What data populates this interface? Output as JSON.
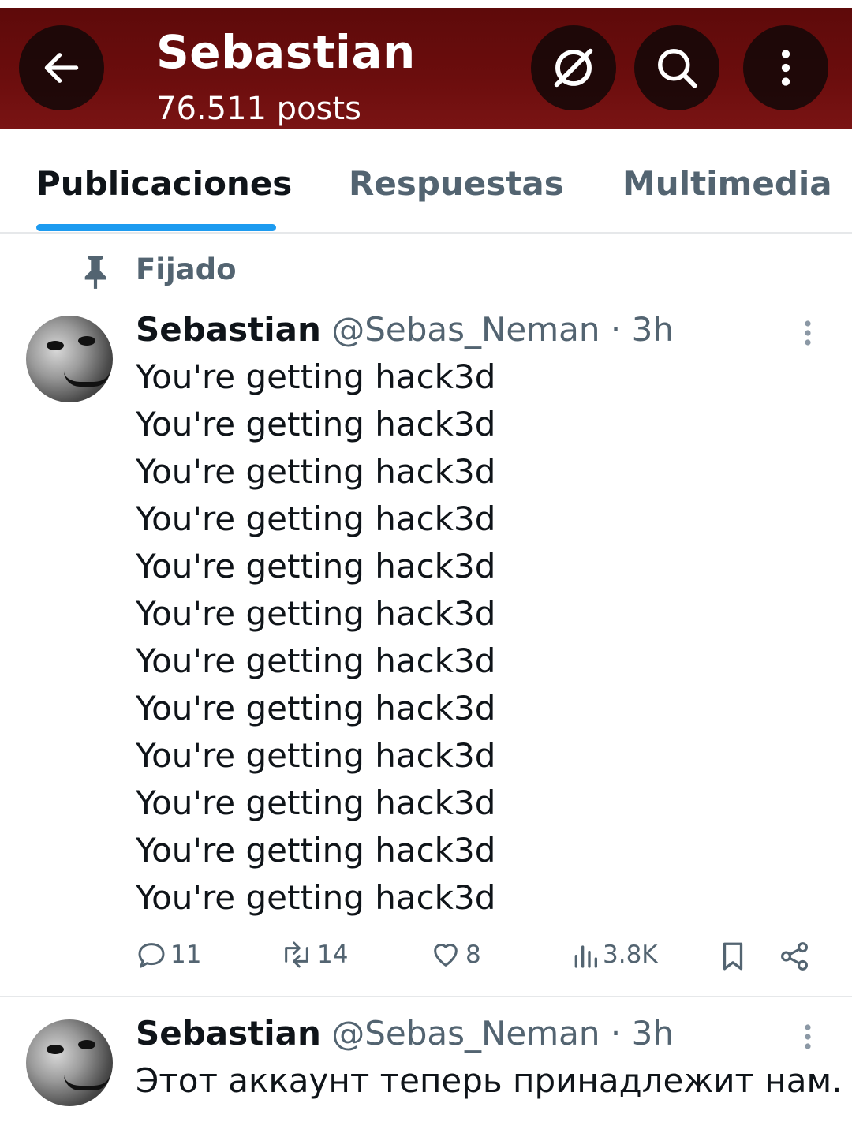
{
  "header": {
    "title": "Sebastian",
    "post_count": "76.511 posts",
    "icons": [
      "back-arrow-icon",
      "no-symbol-icon",
      "search-icon",
      "more-vertical-icon"
    ],
    "background": "#6b0d0d"
  },
  "tabs": [
    {
      "label": "Publicaciones",
      "active": true
    },
    {
      "label": "Respuestas",
      "active": false
    },
    {
      "label": "Multimedia",
      "active": false
    }
  ],
  "accent": "#1d9bf0",
  "pinned_label": "Fijado",
  "tweets": [
    {
      "name": "Sebastian",
      "handle": "@Sebas_Neman",
      "time": "· 3h",
      "lines": [
        "You're getting hack3d",
        "You're getting hack3d",
        "You're getting hack3d",
        "You're getting hack3d",
        "You're getting hack3d",
        "You're getting hack3d",
        "You're getting hack3d",
        "You're getting hack3d",
        "You're getting hack3d",
        "You're getting hack3d",
        "You're getting hack3d",
        "You're getting hack3d"
      ],
      "replies": "11",
      "reposts": "14",
      "likes": "8",
      "views": "3.8K"
    },
    {
      "name": "Sebastian",
      "handle": "@Sebas_Neman",
      "time": "· 3h",
      "lines": [
        "Этот аккаунт теперь принадлежит нам."
      ]
    }
  ]
}
